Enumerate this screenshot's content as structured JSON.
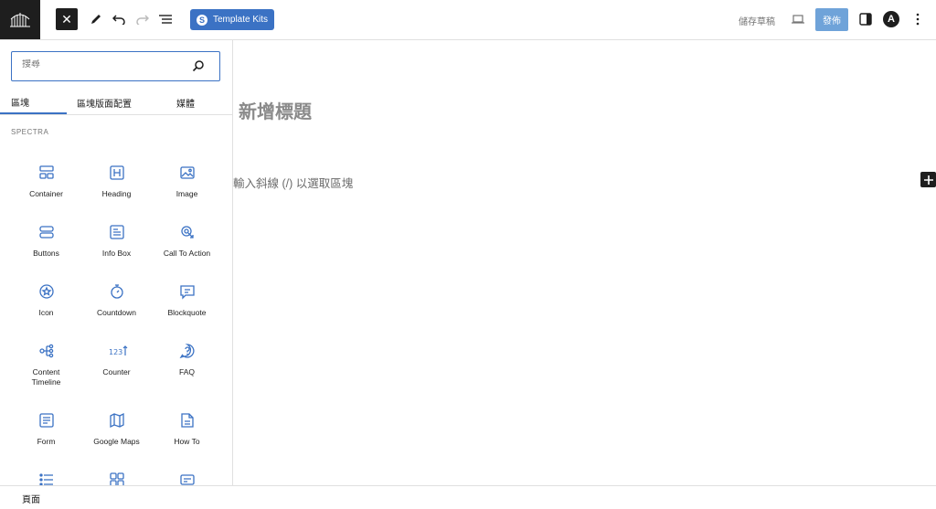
{
  "header": {
    "template_kits_label": "Template Kits",
    "save_draft_label": "儲存草稿",
    "publish_label": "發佈",
    "astra_initial": "A"
  },
  "inserter": {
    "search_placeholder": "搜尋",
    "tabs": [
      "區塊",
      "區塊版面配置",
      "媒體"
    ],
    "active_tab": "區塊",
    "section_label": "SPECTRA",
    "blocks": [
      {
        "label": "Container",
        "icon": "container-icon"
      },
      {
        "label": "Heading",
        "icon": "heading-icon"
      },
      {
        "label": "Image",
        "icon": "image-icon"
      },
      {
        "label": "Buttons",
        "icon": "buttons-icon"
      },
      {
        "label": "Info Box",
        "icon": "info-box-icon"
      },
      {
        "label": "Call To Action",
        "icon": "call-to-action-icon"
      },
      {
        "label": "Icon",
        "icon": "star-icon"
      },
      {
        "label": "Countdown",
        "icon": "timer-icon"
      },
      {
        "label": "Blockquote",
        "icon": "quote-icon"
      },
      {
        "label": "Content Timeline",
        "icon": "timeline-icon"
      },
      {
        "label": "Counter",
        "icon": "counter-icon"
      },
      {
        "label": "FAQ",
        "icon": "faq-icon"
      },
      {
        "label": "Form",
        "icon": "form-icon"
      },
      {
        "label": "Google Maps",
        "icon": "map-icon"
      },
      {
        "label": "How To",
        "icon": "how-to-icon"
      },
      {
        "label": "",
        "icon": "list-icon"
      },
      {
        "label": "",
        "icon": "grid-icon"
      },
      {
        "label": "",
        "icon": "card-icon"
      }
    ]
  },
  "editor": {
    "title_placeholder": "新增標題",
    "paragraph_placeholder": "輸入斜線 (/) 以選取區塊"
  },
  "footer": {
    "breadcrumb": "頁面"
  },
  "colors": {
    "accent": "#3b72c4",
    "dark": "#1e1e1e",
    "publish": "#6fa3d9"
  }
}
